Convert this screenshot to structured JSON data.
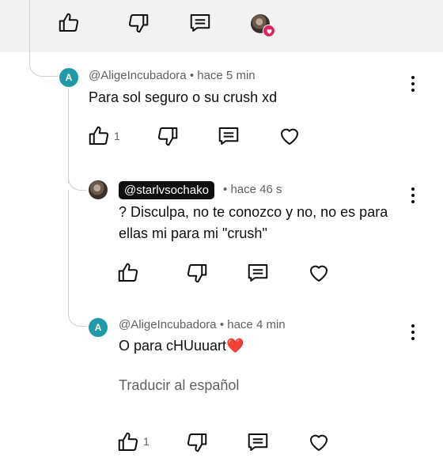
{
  "comments": [
    {
      "handle": "@AligeIncubadora",
      "separator": "•",
      "time": "hace 5 min",
      "text": "Para sol seguro o su crush xd",
      "like_count": "1",
      "avatar_letter": "A"
    },
    {
      "handle": "@starlvsochako",
      "separator": "•",
      "time": "hace 46 s",
      "text_line1": "? Disculpa, no te conozco y no, no es para",
      "text_line2": "ellas mi para mi \"crush\""
    },
    {
      "handle": "@AligeIncubadora",
      "separator": "•",
      "time": "hace 4 min",
      "text": "O para cHUuuart❤️",
      "translate": "Traducir al español",
      "like_count": "1",
      "avatar_letter": "A"
    }
  ],
  "colors": {
    "avatar_teal": "#1f9aa6",
    "heart_badge": "#e0245e",
    "top_band": "#f2f2f2"
  },
  "icons": [
    "like-icon",
    "dislike-icon",
    "reply-icon",
    "heart-icon",
    "more-options-icon",
    "creator-heart-badge"
  ]
}
